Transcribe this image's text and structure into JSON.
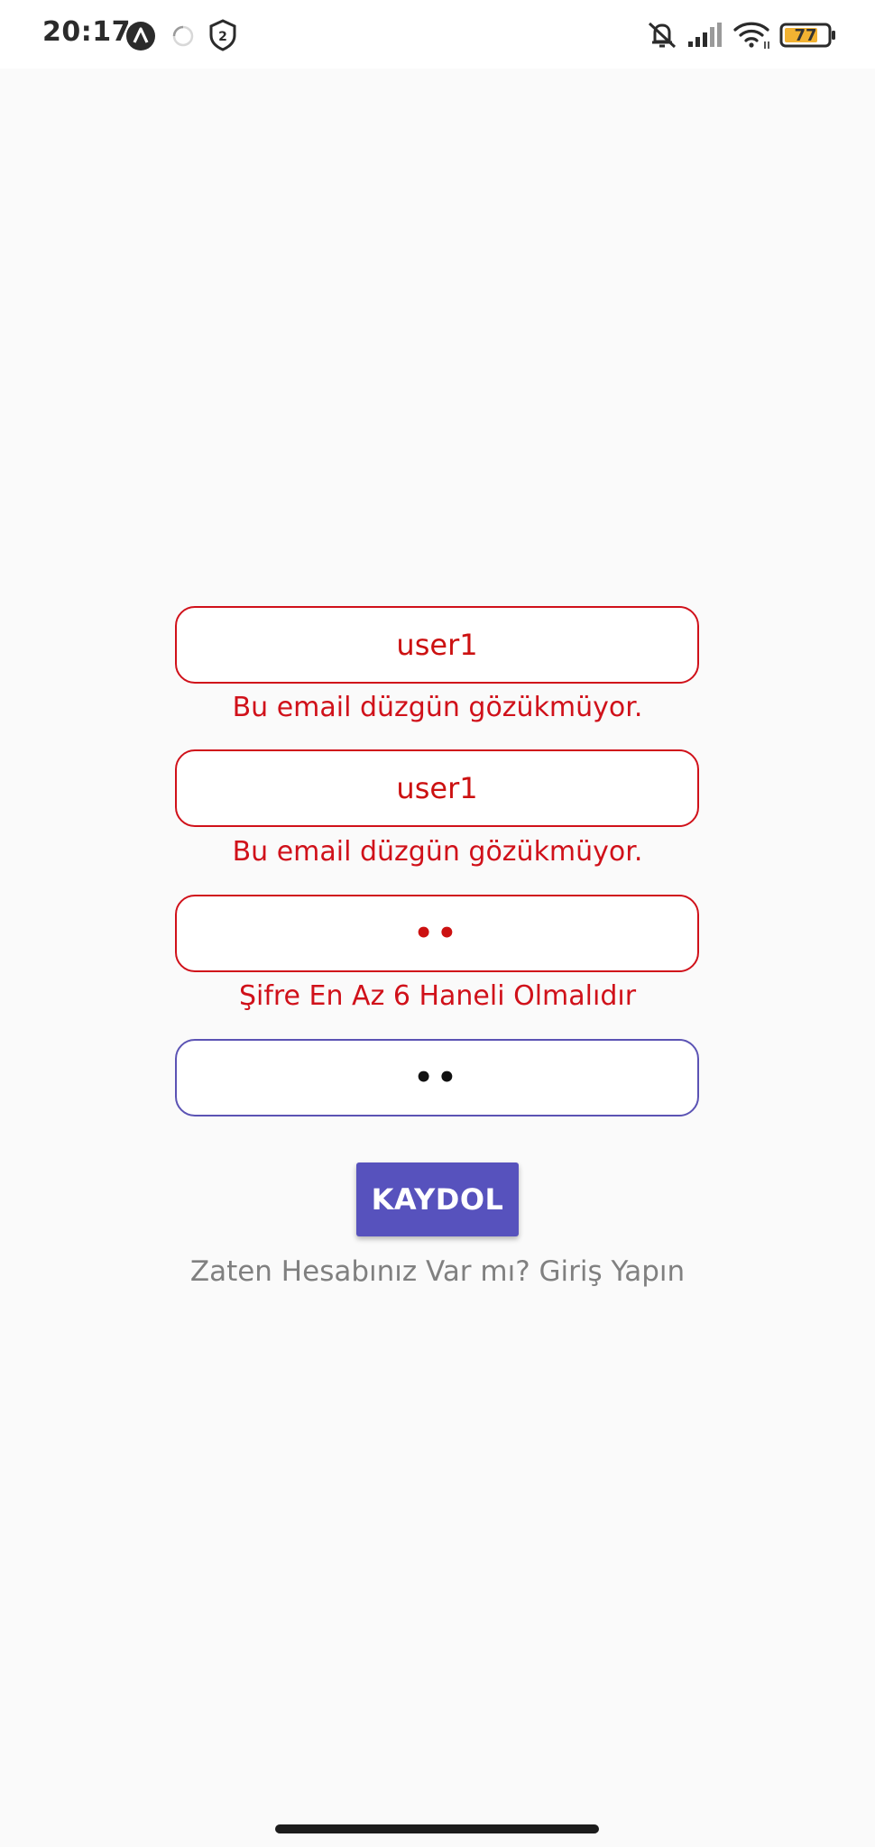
{
  "status_bar": {
    "time": "20:17",
    "battery_level": "77",
    "notification_count": "2",
    "icons": [
      "app-notification-icon",
      "loading-icon",
      "shield-icon",
      "mute-icon",
      "signal-icon",
      "wifi-icon",
      "battery-icon"
    ]
  },
  "form": {
    "email_field": {
      "value": "user1",
      "error": "Bu email düzgün gözükmüyor."
    },
    "confirm_email_field": {
      "value": "user1",
      "error": "Bu email düzgün gözükmüyor."
    },
    "password_field": {
      "value": "••",
      "error": "Şifre En Az 6 Haneli Olmalıdır"
    },
    "confirm_password_field": {
      "value": "••"
    },
    "submit_label": "KAYDOL",
    "login_link": "Zaten Hesabınız Var mı? Giriş Yapın"
  },
  "colors": {
    "error": "#d0111a",
    "accent": "#5752bd",
    "valid_border": "#5b53b4",
    "link": "#808080",
    "background": "#fafafa"
  }
}
